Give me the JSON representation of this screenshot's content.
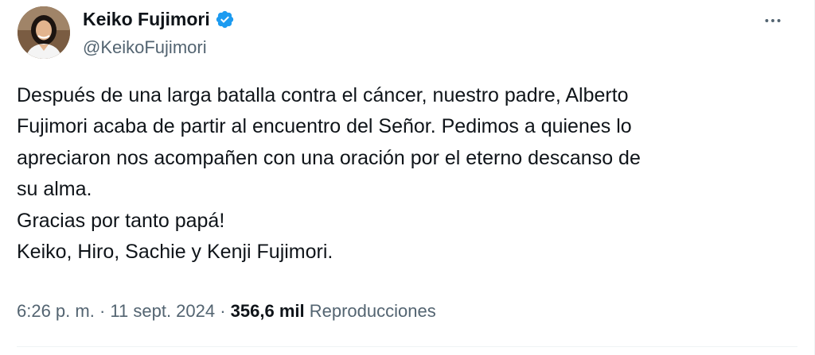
{
  "author": {
    "display_name": "Keiko Fujimori",
    "handle": "@KeikoFujimori",
    "verified": true,
    "avatar_icon": "profile-photo",
    "verified_icon": "verified-badge-icon"
  },
  "menu": {
    "icon": "more-horizontal-icon"
  },
  "tweet": {
    "text": "Después de una larga batalla contra el cáncer, nuestro padre, Alberto\nFujimori acaba de partir al encuentro del Señor. Pedimos a quienes lo\napreciaron nos acompañen con una oración por el eterno descanso de\nsu alma.\nGracias por tanto papá!\nKeiko, Hiro, Sachie y Kenji Fujimori."
  },
  "meta": {
    "time": "6:26 p. m.",
    "separator": " · ",
    "date": "11 sept. 2024",
    "views_count": "356,6 mil",
    "views_label": "Reproducciones"
  },
  "colors": {
    "text_primary": "#0f1419",
    "text_secondary": "#536471",
    "verified_blue": "#1d9bf0",
    "divider": "#eff3f4"
  }
}
